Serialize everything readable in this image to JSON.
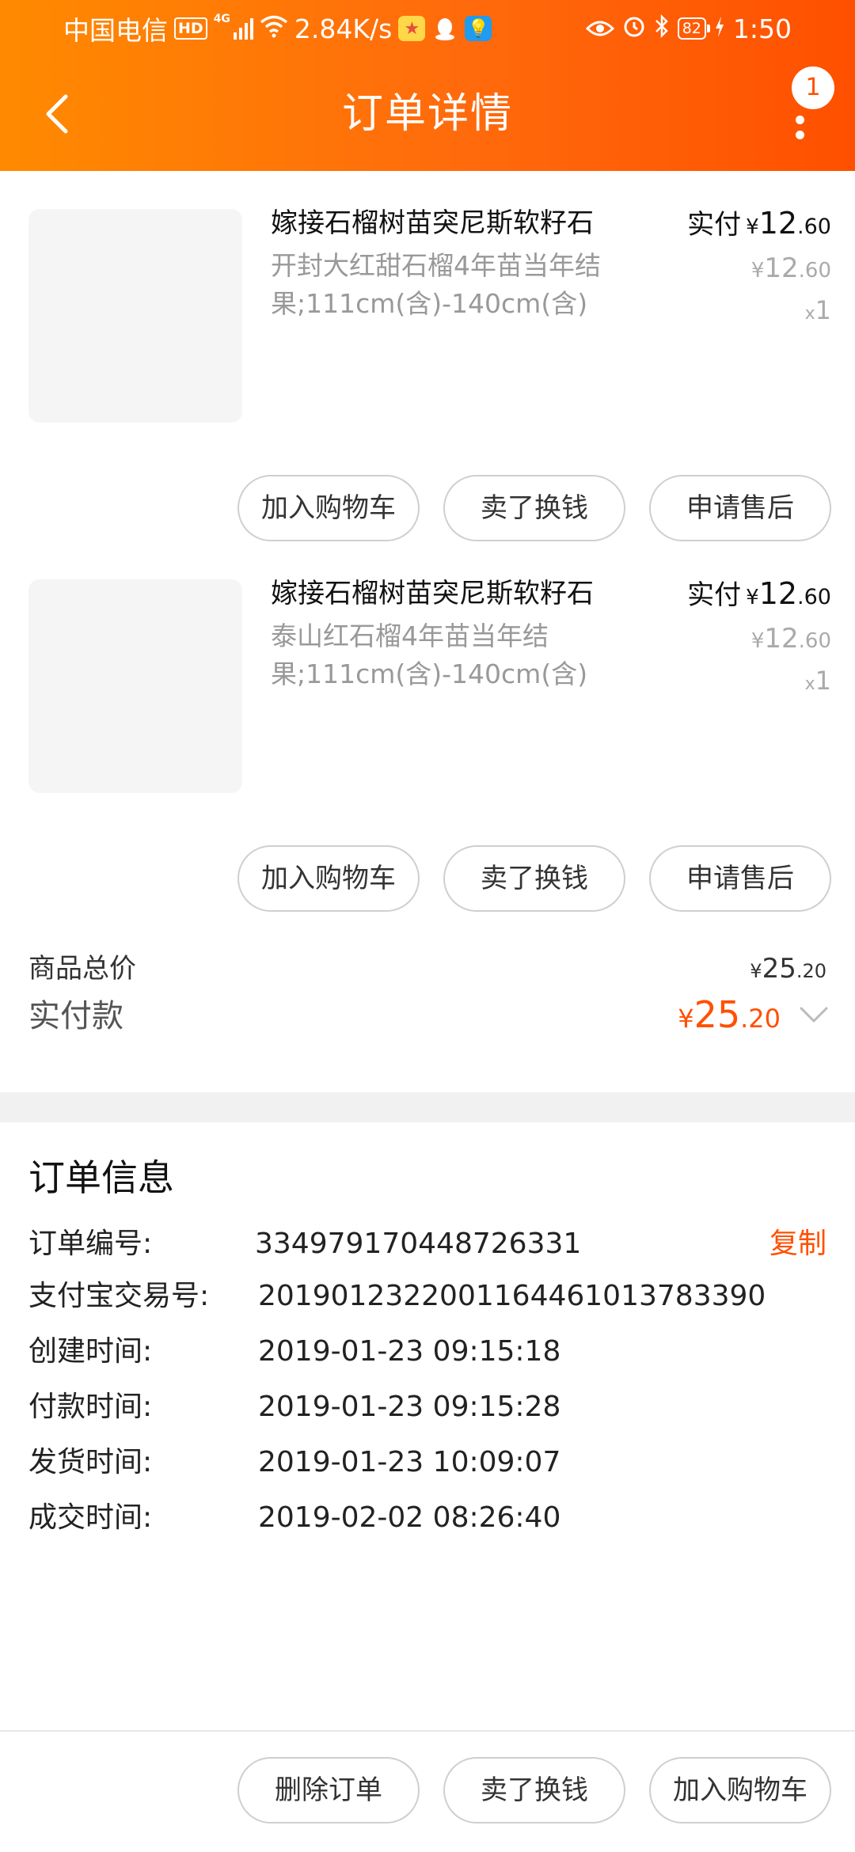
{
  "status_bar": {
    "carrier": "中国电信",
    "hd": "HD",
    "network": "4G",
    "speed": "2.84K/s",
    "battery": "82",
    "time": "1:50"
  },
  "header": {
    "title": "订单详情",
    "notification_count": "1"
  },
  "items": [
    {
      "title": "嫁接石榴树苗突尼斯软籽石",
      "spec": "开封大红甜石榴4年苗当年结果;111cm(含)-140cm(含)",
      "paid_label": "实付",
      "currency": "¥",
      "paid_int": "12",
      "paid_dec": ".60",
      "orig_int": "12",
      "orig_dec": ".60",
      "qty_prefix": "x",
      "qty": "1",
      "buttons": [
        "加入购物车",
        "卖了换钱",
        "申请售后"
      ]
    },
    {
      "title": "嫁接石榴树苗突尼斯软籽石",
      "spec": "泰山红石榴4年苗当年结果;111cm(含)-140cm(含)",
      "paid_label": "实付",
      "currency": "¥",
      "paid_int": "12",
      "paid_dec": ".60",
      "orig_int": "12",
      "orig_dec": ".60",
      "qty_prefix": "x",
      "qty": "1",
      "buttons": [
        "加入购物车",
        "卖了换钱",
        "申请售后"
      ]
    }
  ],
  "totals": {
    "subtotal_label": "商品总价",
    "subtotal_currency": "¥",
    "subtotal_int": "25",
    "subtotal_dec": ".20",
    "paid_label": "实付款",
    "paid_currency": "¥",
    "paid_int": "25",
    "paid_dec": ".20"
  },
  "order_info": {
    "title": "订单信息",
    "copy_label": "复制",
    "rows": [
      {
        "label": "订单编号:",
        "value": "334979170448726331"
      },
      {
        "label": "支付宝交易号:",
        "value": "2019012322001164461013783390"
      },
      {
        "label": "创建时间:",
        "value": "2019-01-23 09:15:18"
      },
      {
        "label": "付款时间:",
        "value": "2019-01-23 09:15:28"
      },
      {
        "label": "发货时间:",
        "value": "2019-01-23 10:09:07"
      },
      {
        "label": "成交时间:",
        "value": "2019-02-02 08:26:40"
      }
    ]
  },
  "footer": {
    "buttons": [
      "删除订单",
      "卖了换钱",
      "加入购物车"
    ]
  },
  "colors": {
    "accent": "#ff5000",
    "header_start": "#ff8a00",
    "header_end": "#ff5000"
  }
}
